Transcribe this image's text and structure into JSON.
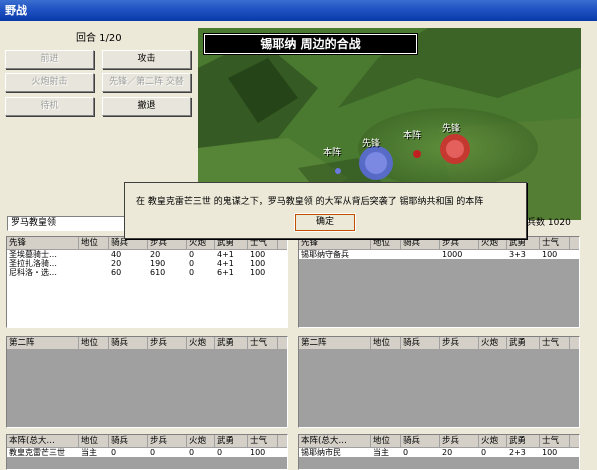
{
  "window": {
    "title": "野战"
  },
  "turn": "回合 1/20",
  "buttons": {
    "advance": "前进",
    "attack": "攻击",
    "fire": "火炮射击",
    "swap": "先锋／第二阵 交替",
    "wait": "待机",
    "retreat": "撤退"
  },
  "map": {
    "title": "锡耶纳 周边的合战",
    "labels": {
      "player_main": "本阵",
      "player_van": "先锋",
      "enemy_main": "本阵",
      "enemy_van": "先锋"
    },
    "colors": {
      "player": "#5a6ad8",
      "enemy": "#e04040"
    }
  },
  "commander": {
    "left": "罗马教皇领",
    "right_count_label": "兵数",
    "right_count": "1020"
  },
  "dialog": {
    "message": "在 教皇克雷芒三世 的鬼谋之下，罗马教皇领 的大军从背后突袭了 锡耶纳共和国 的本阵",
    "ok": "确定"
  },
  "columns": {
    "rank": "地位",
    "cavalry": "骑兵",
    "infantry": "步兵",
    "artillery": "火炮",
    "valor": "武勇",
    "morale": "士气"
  },
  "left": {
    "vanguard": {
      "title": "先锋",
      "rows": [
        {
          "name": "圣埃墓骑士…",
          "rank": "",
          "cavalry": "40",
          "infantry": "20",
          "artillery": "0",
          "valor": "4+1",
          "morale": "100"
        },
        {
          "name": "圣拉扎洛骑…",
          "rank": "",
          "cavalry": "20",
          "infantry": "190",
          "artillery": "0",
          "valor": "4+1",
          "morale": "100"
        },
        {
          "name": "尼科洛・选…",
          "rank": "",
          "cavalry": "60",
          "infantry": "610",
          "artillery": "0",
          "valor": "6+1",
          "morale": "100"
        }
      ]
    },
    "second": {
      "title": "第二阵",
      "rows": []
    },
    "main": {
      "title": "本阵(总大…",
      "rows": [
        {
          "name": "教皇克雷芒三世",
          "rank": "当主",
          "cavalry": "0",
          "infantry": "0",
          "artillery": "0",
          "valor": "0",
          "morale": "100"
        }
      ]
    }
  },
  "right": {
    "vanguard": {
      "title": "先锋",
      "rows": [
        {
          "name": "锡耶纳守备兵",
          "rank": "",
          "cavalry": "",
          "infantry": "1000",
          "artillery": "",
          "valor": "3+3",
          "morale": "100"
        }
      ]
    },
    "second": {
      "title": "第二阵",
      "rows": []
    },
    "main": {
      "title": "本阵(总大…",
      "rows": [
        {
          "name": "锡耶纳市民",
          "rank": "当主",
          "cavalry": "0",
          "infantry": "20",
          "artillery": "0",
          "valor": "2+3",
          "morale": "100"
        }
      ]
    }
  }
}
